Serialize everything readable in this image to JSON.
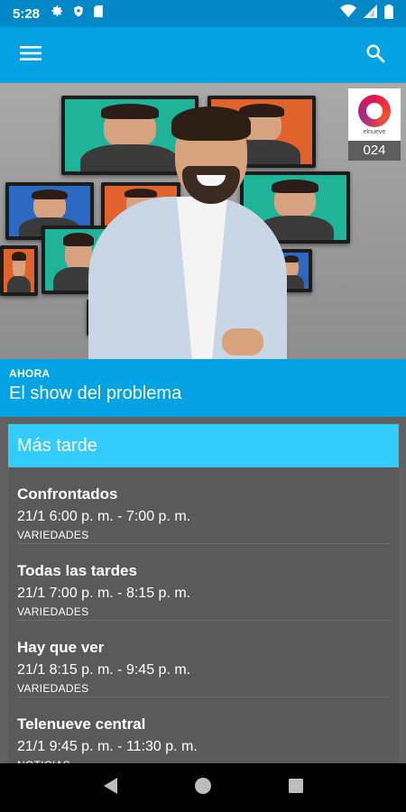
{
  "status_bar": {
    "time": "5:28",
    "left_icons": [
      "gear-icon",
      "shield-icon",
      "sd-card-icon"
    ],
    "right_icons": [
      "wifi-icon",
      "signal-icon",
      "battery-icon"
    ]
  },
  "app_bar": {
    "menu_icon": "menu-icon",
    "search_icon": "search-icon"
  },
  "hero": {
    "channel_logo_text": "elnueve",
    "channel_number": "024"
  },
  "now": {
    "label": "AHORA",
    "title": "El show del problema"
  },
  "later": {
    "header": "Más tarde",
    "items": [
      {
        "title": "Confrontados",
        "time": "21/1 6:00 p. m. - 7:00 p. m.",
        "genre": "VARIEDADES"
      },
      {
        "title": "Todas las tardes",
        "time": "21/1 7:00 p. m. - 8:15 p. m.",
        "genre": "VARIEDADES"
      },
      {
        "title": "Hay que ver",
        "time": "21/1 8:15 p. m. - 9:45 p. m.",
        "genre": "VARIEDADES"
      },
      {
        "title": "Telenueve central",
        "time": "21/1 9:45 p. m. - 11:30 p. m.",
        "genre": "NOTICIAS"
      }
    ]
  },
  "nav_bar": {
    "back_icon": "back-icon",
    "home_icon": "home-icon",
    "recents_icon": "recents-icon"
  },
  "colors": {
    "status_bar": "#0288c7",
    "app_bar": "#03a2e2",
    "later_header": "#33ccff",
    "background": "#616161"
  }
}
